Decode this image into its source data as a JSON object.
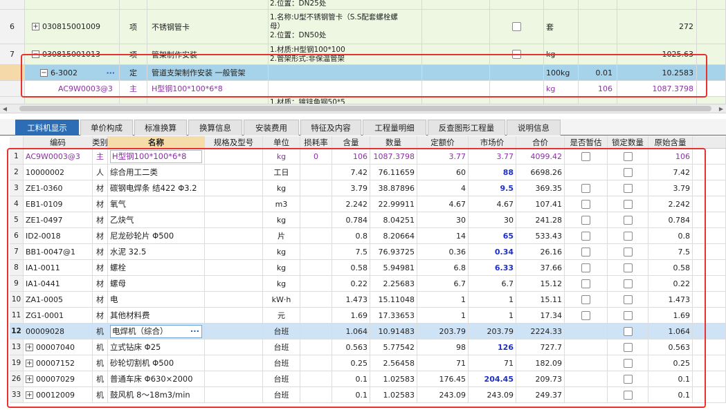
{
  "top_grid": {
    "rows": [
      {
        "num": "",
        "code": "",
        "type": "",
        "name": "",
        "feature_lines": [
          "2.位置：DN25处"
        ],
        "unit": "",
        "q1": "",
        "q2": ""
      },
      {
        "num": "6",
        "code": "030815001009",
        "type": "项",
        "name": "不锈钢管卡",
        "feature_lines": [
          "1.名称:U型不锈钢管卡（S.S配套螺栓螺",
          "母）",
          "2.位置：DN50处"
        ],
        "unit": "套",
        "q1": "",
        "q2": "272"
      },
      {
        "num": "7",
        "code": "030815001013",
        "type": "项",
        "name": "管架制作安装",
        "feature_lines": [
          "1.材质:H型钢100*100",
          "2.管架形式:非保温管架"
        ],
        "unit": "kg",
        "q1": "",
        "q2": "1025.63"
      },
      {
        "num": "",
        "code": "6-3002",
        "type": "定",
        "name": "管道支架制作安装 一般管架",
        "feature_lines": [],
        "unit": "100kg",
        "q1": "0.01",
        "q2": "10.2583"
      },
      {
        "num": "",
        "code": "AC9W0003@3",
        "type": "主",
        "name": "H型钢100*100*6*8",
        "feature_lines": [],
        "unit": "kg",
        "q1": "106",
        "q2": "1087.3798"
      },
      {
        "num": "",
        "code": "",
        "type": "",
        "name": "",
        "feature_lines": [
          "1.材质：镀锌角钢50*5"
        ],
        "unit": "",
        "q1": "",
        "q2": ""
      }
    ]
  },
  "tabs": [
    "工料机显示",
    "单价构成",
    "标准换算",
    "换算信息",
    "安装费用",
    "特征及内容",
    "工程量明细",
    "反查图形工程量",
    "说明信息"
  ],
  "grid": {
    "headers": [
      "编码",
      "类别",
      "名称",
      "规格及型号",
      "单位",
      "损耗率",
      "含量",
      "数量",
      "定额价",
      "市场价",
      "合价",
      "是否暂估",
      "锁定数量",
      "原始含量"
    ],
    "rows": [
      {
        "num": "1",
        "code": "AC9W0003@3",
        "cat": "主",
        "name": "H型钢100*100*6*8",
        "spec": "",
        "unit": "kg",
        "loss": "0",
        "qty": "106",
        "amount": "1087.3798",
        "quota": "3.77",
        "market": "3.77",
        "total": "4099.42",
        "temp": true,
        "lock": true,
        "orig": "106"
      },
      {
        "num": "2",
        "code": "10000002",
        "cat": "人",
        "name": "综合用工二类",
        "spec": "",
        "unit": "工日",
        "loss": "",
        "qty": "7.42",
        "amount": "76.11659",
        "quota": "60",
        "market": "88",
        "total": "6698.26",
        "temp": false,
        "lock": true,
        "orig": "7.42"
      },
      {
        "num": "3",
        "code": "ZE1-0360",
        "cat": "材",
        "name": "碳钢电焊条 结422 Φ3.2",
        "spec": "",
        "unit": "kg",
        "loss": "",
        "qty": "3.79",
        "amount": "38.87896",
        "quota": "4",
        "market": "9.5",
        "total": "369.35",
        "temp": true,
        "lock": true,
        "orig": "3.79"
      },
      {
        "num": "4",
        "code": "EB1-0109",
        "cat": "材",
        "name": "氧气",
        "spec": "",
        "unit": "m3",
        "loss": "",
        "qty": "2.242",
        "amount": "22.99911",
        "quota": "4.67",
        "market": "4.67",
        "total": "107.41",
        "temp": true,
        "lock": true,
        "orig": "2.242"
      },
      {
        "num": "5",
        "code": "ZE1-0497",
        "cat": "材",
        "name": "乙炔气",
        "spec": "",
        "unit": "kg",
        "loss": "",
        "qty": "0.784",
        "amount": "8.04251",
        "quota": "30",
        "market": "30",
        "total": "241.28",
        "temp": true,
        "lock": true,
        "orig": "0.784"
      },
      {
        "num": "6",
        "code": "ID2-0018",
        "cat": "材",
        "name": "尼龙砂轮片 Φ500",
        "spec": "",
        "unit": "片",
        "loss": "",
        "qty": "0.8",
        "amount": "8.20664",
        "quota": "14",
        "market": "65",
        "total": "533.43",
        "temp": true,
        "lock": true,
        "orig": "0.8"
      },
      {
        "num": "7",
        "code": "BB1-0047@1",
        "cat": "材",
        "name": "水泥 32.5",
        "spec": "",
        "unit": "kg",
        "loss": "",
        "qty": "7.5",
        "amount": "76.93725",
        "quota": "0.36",
        "market": "0.34",
        "total": "26.16",
        "temp": true,
        "lock": true,
        "orig": "7.5"
      },
      {
        "num": "8",
        "code": "IA1-0011",
        "cat": "材",
        "name": "螺栓",
        "spec": "",
        "unit": "kg",
        "loss": "",
        "qty": "0.58",
        "amount": "5.94981",
        "quota": "6.8",
        "market": "6.33",
        "total": "37.66",
        "temp": true,
        "lock": true,
        "orig": "0.58"
      },
      {
        "num": "9",
        "code": "IA1-0441",
        "cat": "材",
        "name": "螺母",
        "spec": "",
        "unit": "kg",
        "loss": "",
        "qty": "0.22",
        "amount": "2.25683",
        "quota": "6.7",
        "market": "6.7",
        "total": "15.12",
        "temp": true,
        "lock": true,
        "orig": "0.22"
      },
      {
        "num": "10",
        "code": "ZA1-0005",
        "cat": "材",
        "name": "电",
        "spec": "",
        "unit": "kW·h",
        "loss": "",
        "qty": "1.473",
        "amount": "15.11048",
        "quota": "1",
        "market": "1",
        "total": "15.11",
        "temp": true,
        "lock": true,
        "orig": "1.473"
      },
      {
        "num": "11",
        "code": "ZG1-0001",
        "cat": "材",
        "name": "其他材料费",
        "spec": "",
        "unit": "元",
        "loss": "",
        "qty": "1.69",
        "amount": "17.33653",
        "quota": "1",
        "market": "1",
        "total": "17.34",
        "temp": true,
        "lock": true,
        "orig": "1.69"
      },
      {
        "num": "12",
        "code": "00009028",
        "cat": "机",
        "name": "电焊机（综合）",
        "spec": "",
        "unit": "台班",
        "loss": "",
        "qty": "1.064",
        "amount": "10.91483",
        "quota": "203.79",
        "market": "203.79",
        "total": "2224.33",
        "temp": false,
        "lock": true,
        "orig": "1.064"
      },
      {
        "num": "13",
        "code": "00007040",
        "cat": "机",
        "name": "立式钻床 Φ25",
        "spec": "",
        "unit": "台班",
        "loss": "",
        "qty": "0.563",
        "amount": "5.77542",
        "quota": "98",
        "market": "126",
        "total": "727.7",
        "temp": false,
        "lock": true,
        "orig": "0.563"
      },
      {
        "num": "19",
        "code": "00007152",
        "cat": "机",
        "name": "砂轮切割机 Φ500",
        "spec": "",
        "unit": "台班",
        "loss": "",
        "qty": "0.25",
        "amount": "2.56458",
        "quota": "71",
        "market": "71",
        "total": "182.09",
        "temp": false,
        "lock": true,
        "orig": "0.25"
      },
      {
        "num": "26",
        "code": "00007029",
        "cat": "机",
        "name": "普通车床 Φ630×2000",
        "spec": "",
        "unit": "台班",
        "loss": "",
        "qty": "0.1",
        "amount": "1.02583",
        "quota": "176.45",
        "market": "204.45",
        "total": "209.73",
        "temp": false,
        "lock": true,
        "orig": "0.1"
      },
      {
        "num": "33",
        "code": "00012009",
        "cat": "机",
        "name": "鼓风机 8～18m3/min",
        "spec": "",
        "unit": "台班",
        "loss": "",
        "qty": "0.1",
        "amount": "1.02583",
        "quota": "243.09",
        "market": "243.09",
        "total": "249.37",
        "temp": false,
        "lock": true,
        "orig": "0.1"
      }
    ]
  },
  "colors": {
    "tab_active": "#2c6db5",
    "selected_row": "#a6d2ea",
    "highlight_row": "#cfe3f7",
    "annotation_box": "#e8312f",
    "market_changed": "#1c2fc8",
    "main_material": "#8b2fa6"
  },
  "icons": {
    "expand": "plus-square-icon",
    "collapse": "minus-square-icon",
    "more": "ellipsis-icon"
  }
}
